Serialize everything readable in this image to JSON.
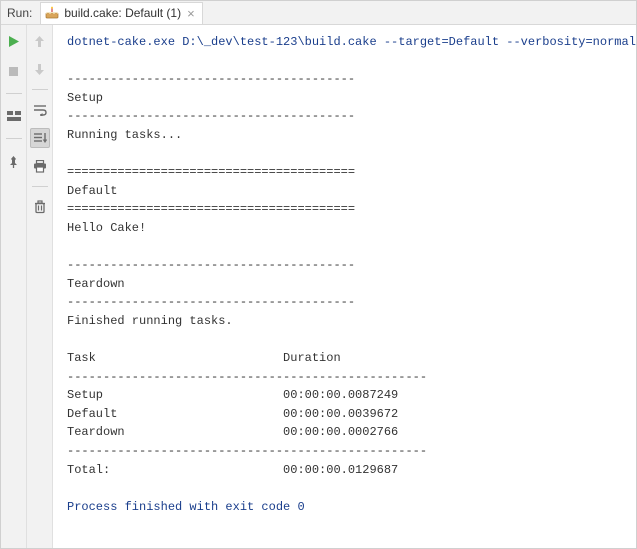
{
  "header": {
    "run_label": "Run:",
    "tab_label": "build.cake: Default (1)"
  },
  "console": {
    "command": "dotnet-cake.exe D:\\_dev\\test-123\\build.cake --target=Default --verbosity=normal",
    "lines": [
      "",
      "----------------------------------------",
      "Setup",
      "----------------------------------------",
      "Running tasks...",
      "",
      "========================================",
      "Default",
      "========================================",
      "Hello Cake!",
      "",
      "----------------------------------------",
      "Teardown",
      "----------------------------------------",
      "Finished running tasks.",
      "",
      "Task                          Duration            ",
      "--------------------------------------------------",
      "Setup                         00:00:00.0087249    ",
      "Default                       00:00:00.0039672    ",
      "Teardown                      00:00:00.0002766    ",
      "--------------------------------------------------",
      "Total:                        00:00:00.0129687    "
    ],
    "status": "Process finished with exit code 0"
  }
}
